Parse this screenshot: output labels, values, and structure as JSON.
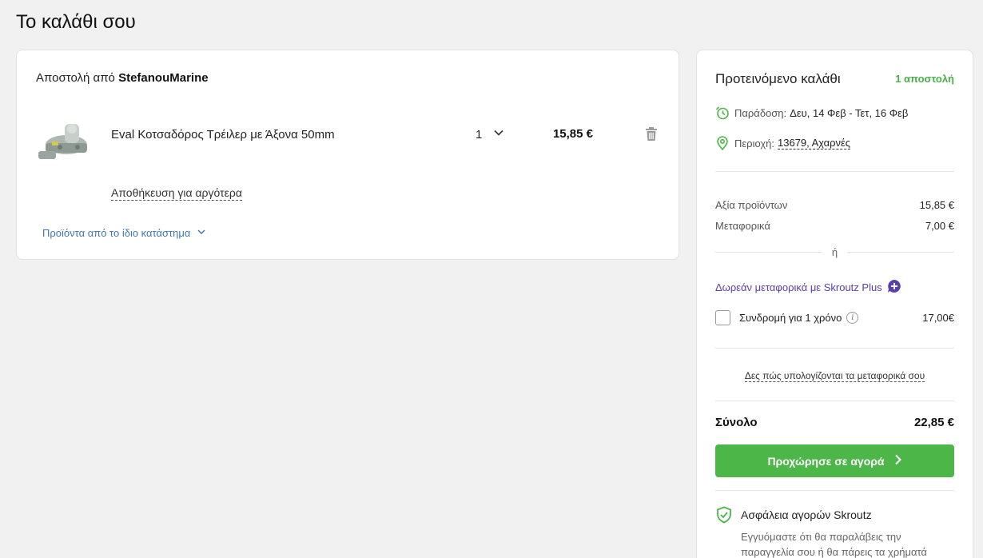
{
  "page": {
    "title": "Το καλάθι σου"
  },
  "cart": {
    "shipment_prefix": "Αποστολή από",
    "store_name": "StefanouMarine",
    "item": {
      "name": "Eval Κοτσαδόρος Τρέιλερ με Άξονα 50mm",
      "quantity": "1",
      "price": "15,85 €",
      "image_icon": "trailer-coupling-image"
    },
    "save_later": "Αποθήκευση για αργότερα",
    "same_store_products": "Προϊόντα από το ίδιο κατάστημα"
  },
  "summary": {
    "title": "Προτεινόμενο καλάθι",
    "shipments_badge": "1 αποστολή",
    "delivery_label": "Παράδοση:",
    "delivery_value": "Δευ, 14 Φεβ - Τετ, 16 Φεβ",
    "area_label": "Περιοχή:",
    "area_value": "13679, Αχαρνές",
    "products_value_label": "Αξία προϊόντων",
    "products_value": "15,85 €",
    "shipping_label": "Μεταφορικά",
    "shipping_value": "7,00 €",
    "or_text": "ή",
    "plus_link": "Δωρεάν μεταφορικά με Skroutz Plus",
    "subscription_label": "Συνδρομή για 1 χρόνο",
    "subscription_price": "17,00€",
    "shipping_calc_link": "Δες πώς υπολογίζονται τα μεταφορικά σου",
    "total_label": "Σύνολο",
    "total_value": "22,85 €",
    "checkout_label": "Προχώρησε σε αγορά",
    "safety_title": "Ασφάλεια αγορών Skroutz",
    "safety_text": "Εγγυόμαστε ότι θα παραλάβεις την παραγγελία σου ή θα πάρεις τα χρήματά"
  },
  "colors": {
    "accent_green": "#4cb748",
    "badge_green": "#4aaf4a",
    "plus_purple": "#5a3fb0",
    "link_blue": "#3f78b5"
  }
}
